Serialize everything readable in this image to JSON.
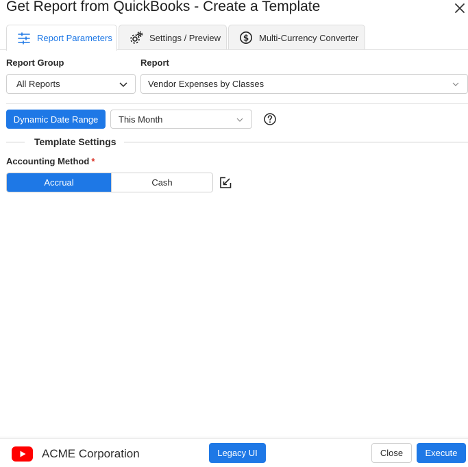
{
  "window": {
    "title": "Get Report from QuickBooks - Create a Template",
    "close_icon": "close-icon"
  },
  "tabs": [
    {
      "label": "Report Parameters",
      "icon": "sliders-icon",
      "active": true
    },
    {
      "label": "Settings / Preview",
      "icon": "gears-icon",
      "active": false
    },
    {
      "label": "Multi-Currency Converter",
      "icon": "dollar-circle-icon",
      "active": false
    }
  ],
  "report_group": {
    "label": "Report Group",
    "value": "All Reports"
  },
  "report": {
    "label": "Report",
    "value": "Vendor Expenses by Classes"
  },
  "date_range": {
    "button_label": "Dynamic Date Range",
    "value": "This Month",
    "help_icon": "help-icon"
  },
  "template_settings": {
    "title": "Template Settings",
    "accounting_method": {
      "label": "Accounting Method",
      "required_mark": "*",
      "options": [
        "Accrual",
        "Cash"
      ],
      "selected": "Accrual"
    },
    "edit_icon": "edit-icon"
  },
  "footer": {
    "company": "ACME Corporation",
    "legacy_label": "Legacy UI",
    "close_label": "Close",
    "execute_label": "Execute"
  },
  "colors": {
    "accent": "#1e78e6",
    "required": "#d93025",
    "youtube": "#ff0000"
  }
}
